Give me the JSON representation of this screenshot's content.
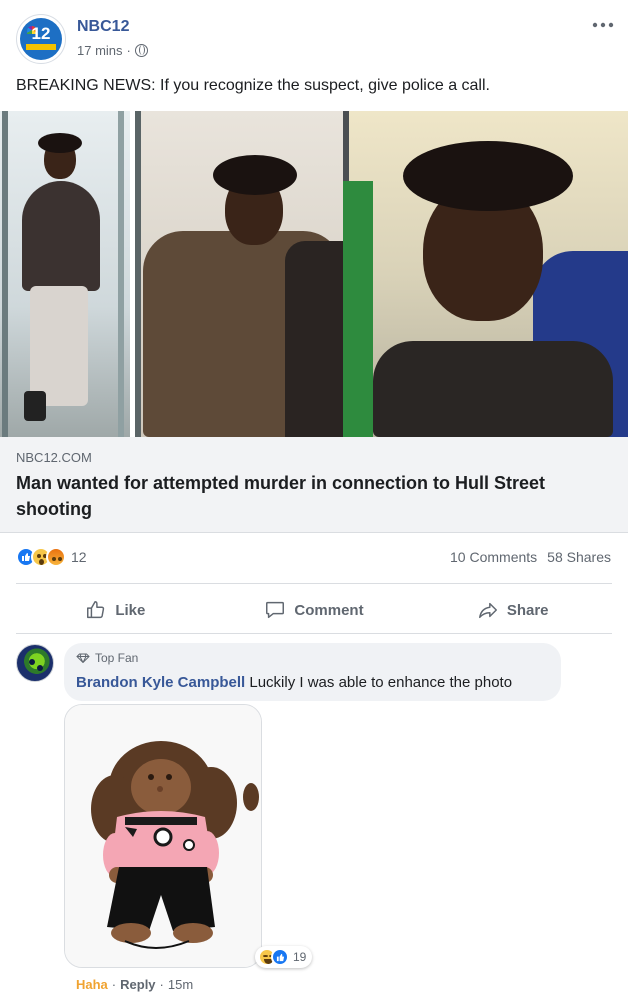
{
  "post": {
    "page_name": "NBC12",
    "avatar_text": "12",
    "time": "17 mins",
    "separator": "·",
    "privacy_icon": "globe-icon",
    "more_icon": "more-horizontal-icon",
    "text": "BREAKING NEWS: If you recognize the suspect, give police a call."
  },
  "link": {
    "domain": "NBC12.COM",
    "headline": "Man wanted for attempted murder in connection to Hull Street shooting"
  },
  "stats": {
    "reaction_icons": [
      "like-icon",
      "wow-icon",
      "angry-icon"
    ],
    "reaction_count": "12",
    "comments": "10 Comments",
    "shares": "58 Shares"
  },
  "actions": {
    "like": "Like",
    "comment": "Comment",
    "share": "Share"
  },
  "comment": {
    "badge": "Top Fan",
    "author": "Brandon Kyle Campbell",
    "text": "Luckily I was able to enhance the photo",
    "reaction_icons": [
      "haha-icon",
      "like-icon"
    ],
    "reaction_count": "19",
    "reaction_label": "Haha",
    "reply_label": "Reply",
    "time": "15m",
    "separator": "·"
  },
  "colors": {
    "brand_blue": "#385898",
    "like_blue": "#1877f2",
    "haha_orange": "#f0a330",
    "muted": "#606770"
  }
}
